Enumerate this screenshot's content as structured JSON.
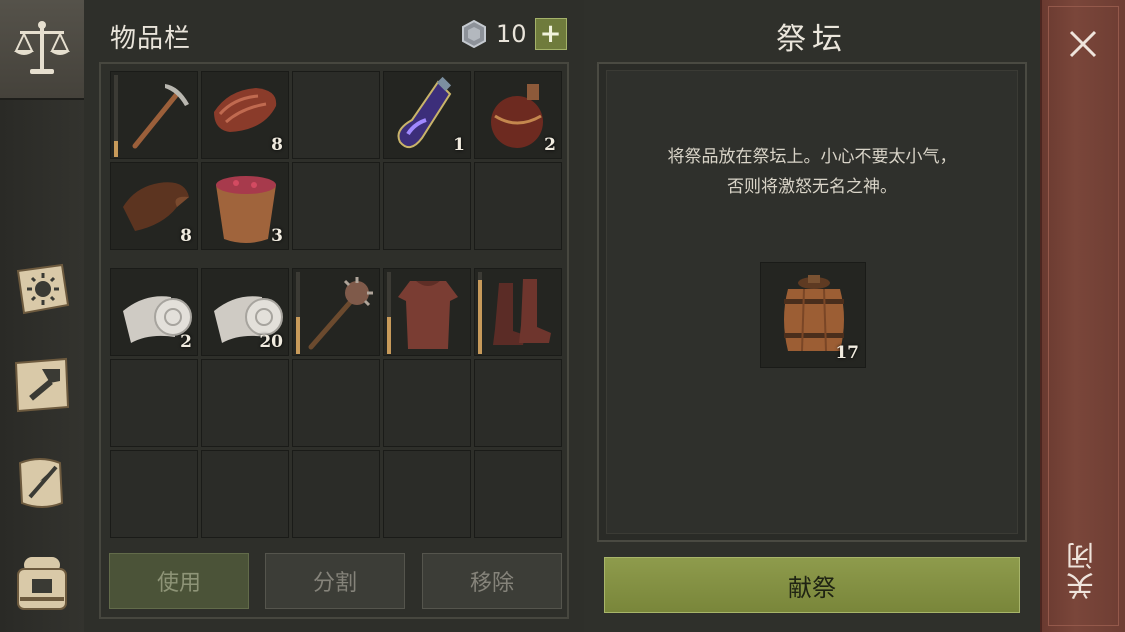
{
  "sidebar": {
    "tabs": [
      {
        "name": "scales-icon",
        "active": true
      },
      {
        "name": "sun-book-icon",
        "active": false
      },
      {
        "name": "hammer-icon",
        "active": false
      },
      {
        "name": "scroll-quill-icon",
        "active": false
      },
      {
        "name": "backpack-icon",
        "active": false
      }
    ]
  },
  "inventory": {
    "title": "物品栏",
    "currency": {
      "icon": "silver-coin-icon",
      "value": "10"
    },
    "add_label": "+",
    "slots_top": [
      {
        "item": "pickaxe-icon",
        "qty": "",
        "durability": 0.2
      },
      {
        "item": "meat-icon",
        "qty": "8"
      },
      {
        "item": "",
        "qty": ""
      },
      {
        "item": "potion-icon",
        "qty": "1"
      },
      {
        "item": "flask-icon",
        "qty": "2"
      },
      {
        "item": "leather-icon",
        "qty": "8"
      },
      {
        "item": "berry-bucket-icon",
        "qty": "3"
      }
    ],
    "slots_bottom": [
      {
        "item": "cloth-roll-icon",
        "qty": "2"
      },
      {
        "item": "cloth-roll-icon",
        "qty": "20"
      },
      {
        "item": "mace-icon",
        "qty": "",
        "durability": 0.45
      },
      {
        "item": "chainmail-icon",
        "qty": "",
        "durability": 0.45
      },
      {
        "item": "boots-icon",
        "qty": "",
        "durability": 0.9
      }
    ],
    "buttons": {
      "use": "使用",
      "split": "分割",
      "remove": "移除"
    }
  },
  "altar": {
    "title": "祭坛",
    "description_line1": "将祭品放在祭坛上。小心不要太小气，",
    "description_line2": "否则将激怒无名之神。",
    "offering": {
      "item": "barrel-icon",
      "qty": "17"
    },
    "sacrifice_label": "献祭"
  },
  "close": {
    "label": "关闭",
    "icon": "close-icon"
  },
  "colors": {
    "accent_green": "#8e9b4c",
    "close_red": "#7a463a",
    "durability": "#c79a5a"
  }
}
